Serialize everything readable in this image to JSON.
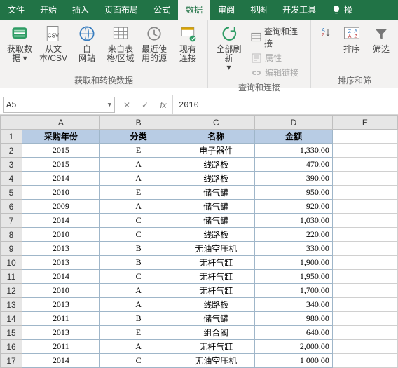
{
  "tabs": {
    "file": "文件",
    "home": "开始",
    "insert": "插入",
    "layout": "页面布局",
    "formulas": "公式",
    "data": "数据",
    "review": "审阅",
    "view": "视图",
    "dev": "开发工具",
    "tell": "操"
  },
  "ribbon": {
    "get_data": "获取数\n据 ▾",
    "from_csv": "从文\n本/CSV",
    "from_web": "自\n网站",
    "from_table": "来自表\n格/区域",
    "recent": "最近使\n用的源",
    "existing": "现有\n连接",
    "group1_title": "获取和转换数据",
    "refresh": "全部刷新\n▾",
    "queries": "查询和连接",
    "properties": "属性",
    "editlinks": "编辑链接",
    "group2_title": "查询和连接",
    "sort": "排序",
    "filter": "筛选",
    "group3_title": "排序和筛"
  },
  "fx": {
    "name": "A5",
    "value": "2010"
  },
  "cols": [
    "A",
    "B",
    "C",
    "D",
    "E"
  ],
  "headers": {
    "c0": "采购年份",
    "c1": "分类",
    "c2": "名称",
    "c3": "金额"
  },
  "rows": [
    {
      "n": 2,
      "c0": "2015",
      "c1": "E",
      "c2": "电子器件",
      "c3": "1,330.00"
    },
    {
      "n": 3,
      "c0": "2015",
      "c1": "A",
      "c2": "线路板",
      "c3": "470.00"
    },
    {
      "n": 4,
      "c0": "2014",
      "c1": "A",
      "c2": "线路板",
      "c3": "390.00"
    },
    {
      "n": 5,
      "c0": "2010",
      "c1": "E",
      "c2": "储气罐",
      "c3": "950.00"
    },
    {
      "n": 6,
      "c0": "2009",
      "c1": "A",
      "c2": "储气罐",
      "c3": "920.00"
    },
    {
      "n": 7,
      "c0": "2014",
      "c1": "C",
      "c2": "储气罐",
      "c3": "1,030.00"
    },
    {
      "n": 8,
      "c0": "2010",
      "c1": "C",
      "c2": "线路板",
      "c3": "220.00"
    },
    {
      "n": 9,
      "c0": "2013",
      "c1": "B",
      "c2": "无油空压机",
      "c3": "330.00"
    },
    {
      "n": 10,
      "c0": "2013",
      "c1": "B",
      "c2": "无杆气缸",
      "c3": "1,900.00"
    },
    {
      "n": 11,
      "c0": "2014",
      "c1": "C",
      "c2": "无杆气缸",
      "c3": "1,950.00"
    },
    {
      "n": 12,
      "c0": "2010",
      "c1": "A",
      "c2": "无杆气缸",
      "c3": "1,700.00"
    },
    {
      "n": 13,
      "c0": "2013",
      "c1": "A",
      "c2": "线路板",
      "c3": "340.00"
    },
    {
      "n": 14,
      "c0": "2011",
      "c1": "B",
      "c2": "储气罐",
      "c3": "980.00"
    },
    {
      "n": 15,
      "c0": "2013",
      "c1": "E",
      "c2": "组合阀",
      "c3": "640.00"
    },
    {
      "n": 16,
      "c0": "2011",
      "c1": "A",
      "c2": "无杆气缸",
      "c3": "2,000.00"
    },
    {
      "n": 17,
      "c0": "2014",
      "c1": "C",
      "c2": "无油空压机",
      "c3": "1 000 00"
    }
  ]
}
